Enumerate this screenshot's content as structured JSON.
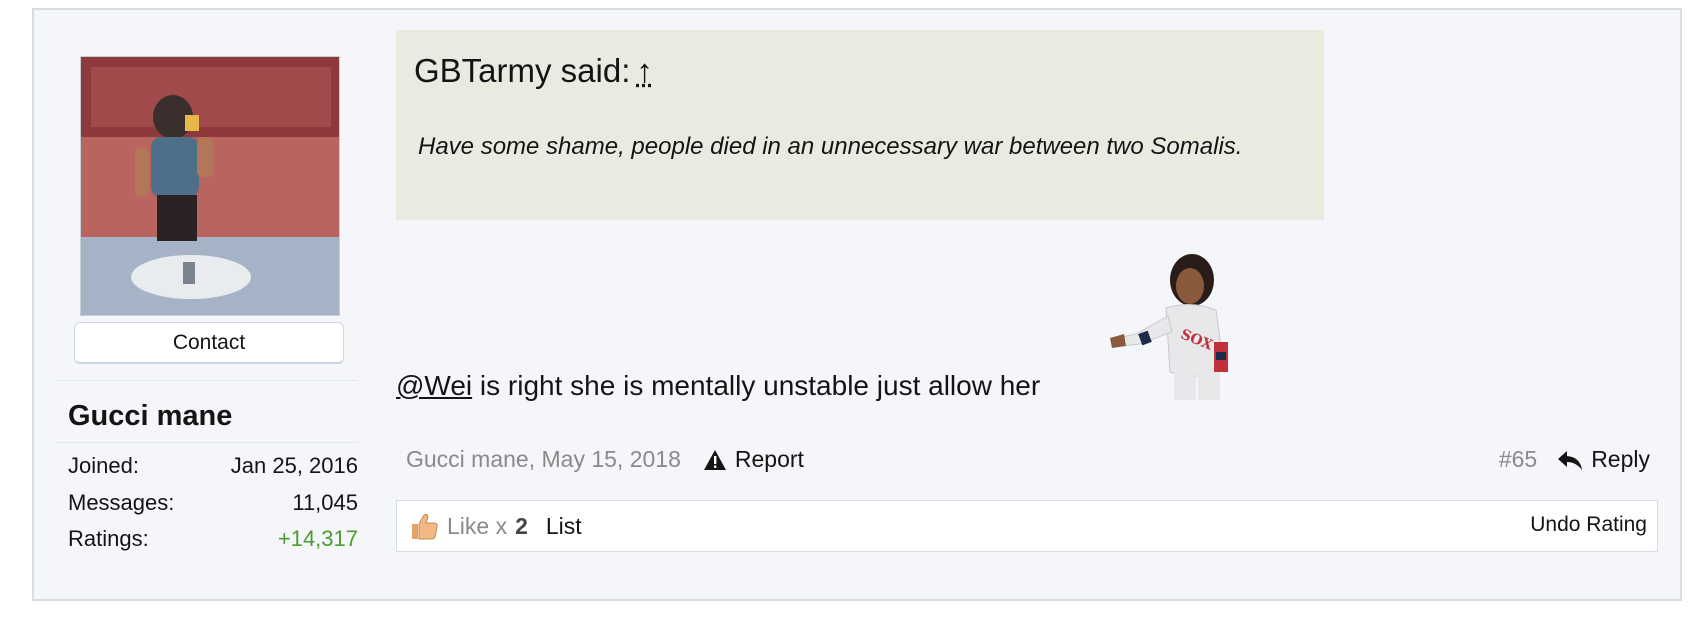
{
  "user": {
    "name": "Gucci mane",
    "contact_label": "Contact",
    "stats": [
      {
        "label": "Joined:",
        "value": "Jan 25, 2016"
      },
      {
        "label": "Messages:",
        "value": "11,045"
      },
      {
        "label": "Ratings:",
        "value": "+14,317"
      }
    ]
  },
  "quote": {
    "author_text": "GBTarmy said:",
    "jump_icon": "↑",
    "body": "Have some shame, people died in an unnecessary war between two Somalis."
  },
  "message": {
    "mention": "@Wei",
    "text": " is right she is mentally unstable just allow her",
    "sticker_icon": "baseball-player-sticker"
  },
  "footer": {
    "author_date": "Gucci mane, May 15, 2018",
    "report_label": "Report",
    "post_number": "#65",
    "reply_label": "Reply"
  },
  "ratings": {
    "like_label": "Like x",
    "like_count": "2",
    "list_label": "List",
    "undo_label": "Undo Rating"
  },
  "colors": {
    "positive": "#4c9c2e",
    "quote_bg": "#ebeae1",
    "post_bg": "#f4f6f9"
  }
}
